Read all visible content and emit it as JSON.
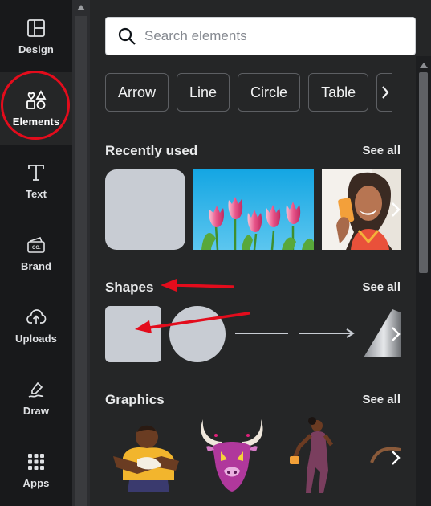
{
  "sidebar": {
    "items": [
      {
        "label": "Design",
        "icon": "layout-icon"
      },
      {
        "label": "Elements",
        "icon": "shapes-icon"
      },
      {
        "label": "Text",
        "icon": "text-t-icon"
      },
      {
        "label": "Brand",
        "icon": "brand-kit-icon"
      },
      {
        "label": "Uploads",
        "icon": "cloud-upload-icon"
      },
      {
        "label": "Draw",
        "icon": "pen-draw-icon"
      },
      {
        "label": "Apps",
        "icon": "apps-grid-icon"
      }
    ],
    "active": "Elements",
    "highlight_color": "#e30c1c"
  },
  "search": {
    "placeholder": "Search elements"
  },
  "chips": [
    "Arrow",
    "Line",
    "Circle",
    "Table"
  ],
  "sections": {
    "recent": {
      "title": "Recently used",
      "see_all": "See all"
    },
    "shapes": {
      "title": "Shapes",
      "see_all": "See all"
    },
    "graphics": {
      "title": "Graphics",
      "see_all": "See all"
    }
  },
  "colors": {
    "panel_bg": "#252627",
    "rail_bg": "#18191b",
    "shape_fill": "#c8ccd3",
    "annotation_arrow": "#e30c1c",
    "accent_line": "#1b8bd1"
  }
}
